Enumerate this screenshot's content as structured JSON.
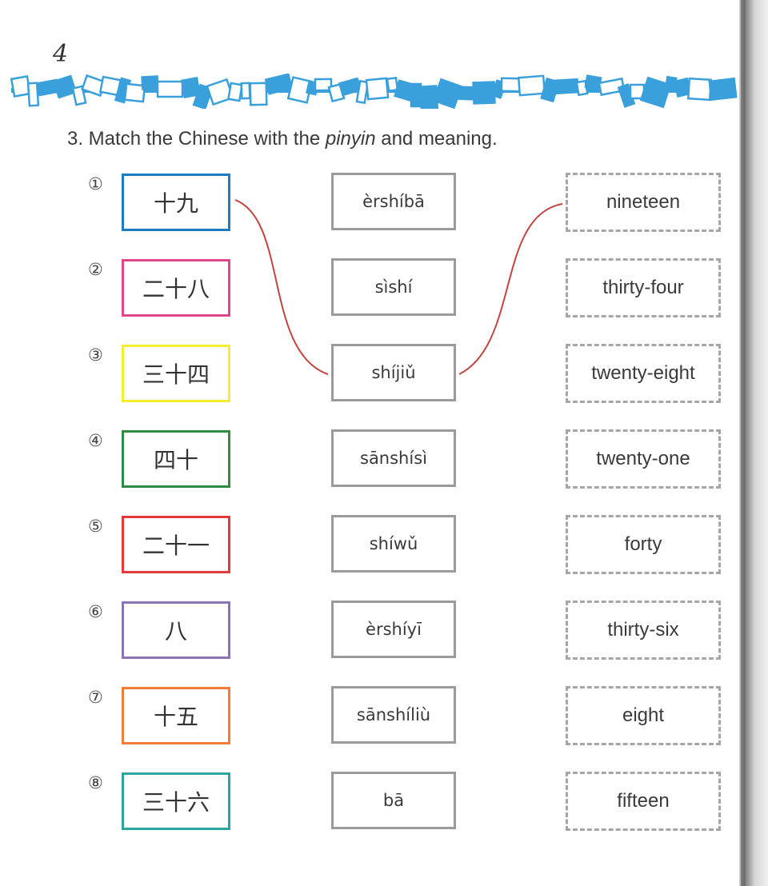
{
  "page_number": "4",
  "instruction": {
    "prefix": "3. Match the Chinese with the ",
    "emphasis": "pinyin",
    "suffix": " and meaning."
  },
  "rows": [
    {
      "num": "①",
      "hanzi": "十九",
      "pinyin": "èrshíbā",
      "meaning": "nineteen",
      "color": "#1f7bc1"
    },
    {
      "num": "②",
      "hanzi": "二十八",
      "pinyin": "sìshí",
      "meaning": "thirty-four",
      "color": "#e0478a"
    },
    {
      "num": "③",
      "hanzi": "三十四",
      "pinyin": "shíjiǔ",
      "meaning": "twenty-eight",
      "color": "#f4ee32"
    },
    {
      "num": "④",
      "hanzi": "四十",
      "pinyin": "sānshísì",
      "meaning": "twenty-one",
      "color": "#2e8c45"
    },
    {
      "num": "⑤",
      "hanzi": "二十一",
      "pinyin": "shíwǔ",
      "meaning": "forty",
      "color": "#e23a3a"
    },
    {
      "num": "⑥",
      "hanzi": "八",
      "pinyin": "èrshíyī",
      "meaning": "thirty-six",
      "color": "#8a74b3"
    },
    {
      "num": "⑦",
      "hanzi": "十五",
      "pinyin": "sānshíliù",
      "meaning": "eight",
      "color": "#f07c38"
    },
    {
      "num": "⑧",
      "hanzi": "三十六",
      "pinyin": "bā",
      "meaning": "fifteen",
      "color": "#2aa5a0"
    }
  ],
  "colors": {
    "border_strip": "#3aa0db",
    "connector": "#c0463f",
    "pinyin_border": "#9a9a9a",
    "meaning_border": "#a6a6a6"
  }
}
